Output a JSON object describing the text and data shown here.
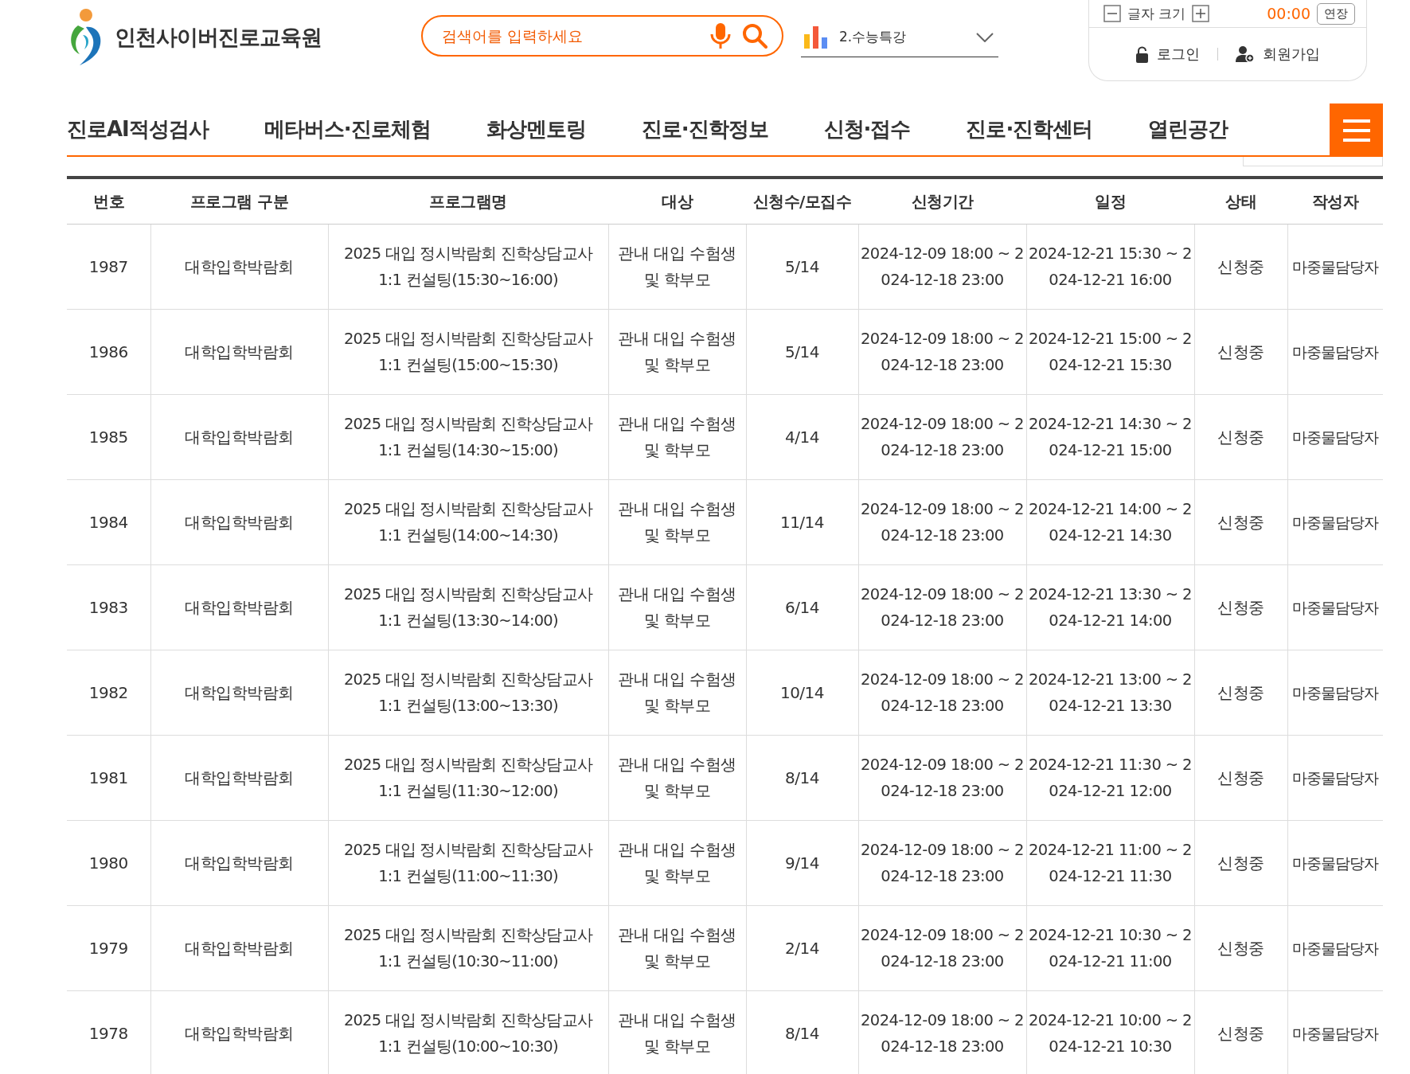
{
  "header": {
    "logo_text": "인천사이버진로교육원",
    "search": {
      "placeholder": "검색어를 입력하세요"
    },
    "channel_select": {
      "value": "2.수능특강"
    },
    "font_size": {
      "label": "글자 크기"
    },
    "timer": "00:00",
    "extend_button": "연장",
    "login": "로그인",
    "signup": "회원가입"
  },
  "nav": {
    "items": [
      {
        "label": "진로AI적성검사"
      },
      {
        "label": "메타버스·진로체험"
      },
      {
        "label": "화상멘토링"
      },
      {
        "label": "진로·진학정보"
      },
      {
        "label": "신청·접수"
      },
      {
        "label": "진로·진학센터"
      },
      {
        "label": "열린공간"
      }
    ]
  },
  "table": {
    "columns": [
      "번호",
      "프로그램 구분",
      "프로그램명",
      "대상",
      "신청수/모집수",
      "신청기간",
      "일정",
      "상태",
      "작성자"
    ],
    "rows": [
      {
        "number": "1987",
        "category": "대학입학박람회",
        "program": "2025 대입 정시박람회 진학상담교사 1:1 컨설팅(15:30~16:00)",
        "target": "관내 대입 수험생 및 학부모",
        "count": "5/14",
        "period": "2024-12-09 18:00 ~ 2024-12-18 23:00",
        "schedule": "2024-12-21 15:30 ~ 2024-12-21 16:00",
        "status": "신청중",
        "author": "마중물담당자"
      },
      {
        "number": "1986",
        "category": "대학입학박람회",
        "program": "2025 대입 정시박람회 진학상담교사 1:1 컨설팅(15:00~15:30)",
        "target": "관내 대입 수험생 및 학부모",
        "count": "5/14",
        "period": "2024-12-09 18:00 ~ 2024-12-18 23:00",
        "schedule": "2024-12-21 15:00 ~ 2024-12-21 15:30",
        "status": "신청중",
        "author": "마중물담당자"
      },
      {
        "number": "1985",
        "category": "대학입학박람회",
        "program": "2025 대입 정시박람회 진학상담교사 1:1 컨설팅(14:30~15:00)",
        "target": "관내 대입 수험생 및 학부모",
        "count": "4/14",
        "period": "2024-12-09 18:00 ~ 2024-12-18 23:00",
        "schedule": "2024-12-21 14:30 ~ 2024-12-21 15:00",
        "status": "신청중",
        "author": "마중물담당자"
      },
      {
        "number": "1984",
        "category": "대학입학박람회",
        "program": "2025 대입 정시박람회 진학상담교사 1:1 컨설팅(14:00~14:30)",
        "target": "관내 대입 수험생 및 학부모",
        "count": "11/14",
        "period": "2024-12-09 18:00 ~ 2024-12-18 23:00",
        "schedule": "2024-12-21 14:00 ~ 2024-12-21 14:30",
        "status": "신청중",
        "author": "마중물담당자"
      },
      {
        "number": "1983",
        "category": "대학입학박람회",
        "program": "2025 대입 정시박람회 진학상담교사 1:1 컨설팅(13:30~14:00)",
        "target": "관내 대입 수험생 및 학부모",
        "count": "6/14",
        "period": "2024-12-09 18:00 ~ 2024-12-18 23:00",
        "schedule": "2024-12-21 13:30 ~ 2024-12-21 14:00",
        "status": "신청중",
        "author": "마중물담당자"
      },
      {
        "number": "1982",
        "category": "대학입학박람회",
        "program": "2025 대입 정시박람회 진학상담교사 1:1 컨설팅(13:00~13:30)",
        "target": "관내 대입 수험생 및 학부모",
        "count": "10/14",
        "period": "2024-12-09 18:00 ~ 2024-12-18 23:00",
        "schedule": "2024-12-21 13:00 ~ 2024-12-21 13:30",
        "status": "신청중",
        "author": "마중물담당자"
      },
      {
        "number": "1981",
        "category": "대학입학박람회",
        "program": "2025 대입 정시박람회 진학상담교사 1:1 컨설팅(11:30~12:00)",
        "target": "관내 대입 수험생 및 학부모",
        "count": "8/14",
        "period": "2024-12-09 18:00 ~ 2024-12-18 23:00",
        "schedule": "2024-12-21 11:30 ~ 2024-12-21 12:00",
        "status": "신청중",
        "author": "마중물담당자"
      },
      {
        "number": "1980",
        "category": "대학입학박람회",
        "program": "2025 대입 정시박람회 진학상담교사 1:1 컨설팅(11:00~11:30)",
        "target": "관내 대입 수험생 및 학부모",
        "count": "9/14",
        "period": "2024-12-09 18:00 ~ 2024-12-18 23:00",
        "schedule": "2024-12-21 11:00 ~ 2024-12-21 11:30",
        "status": "신청중",
        "author": "마중물담당자"
      },
      {
        "number": "1979",
        "category": "대학입학박람회",
        "program": "2025 대입 정시박람회 진학상담교사 1:1 컨설팅(10:30~11:00)",
        "target": "관내 대입 수험생 및 학부모",
        "count": "2/14",
        "period": "2024-12-09 18:00 ~ 2024-12-18 23:00",
        "schedule": "2024-12-21 10:30 ~ 2024-12-21 11:00",
        "status": "신청중",
        "author": "마중물담당자"
      },
      {
        "number": "1978",
        "category": "대학입학박람회",
        "program": "2025 대입 정시박람회 진학상담교사 1:1 컨설팅(10:00~10:30)",
        "target": "관내 대입 수험생 및 학부모",
        "count": "8/14",
        "period": "2024-12-09 18:00 ~ 2024-12-18 23:00",
        "schedule": "2024-12-21 10:00 ~ 2024-12-21 10:30",
        "status": "신청중",
        "author": "마중물담당자"
      }
    ]
  }
}
